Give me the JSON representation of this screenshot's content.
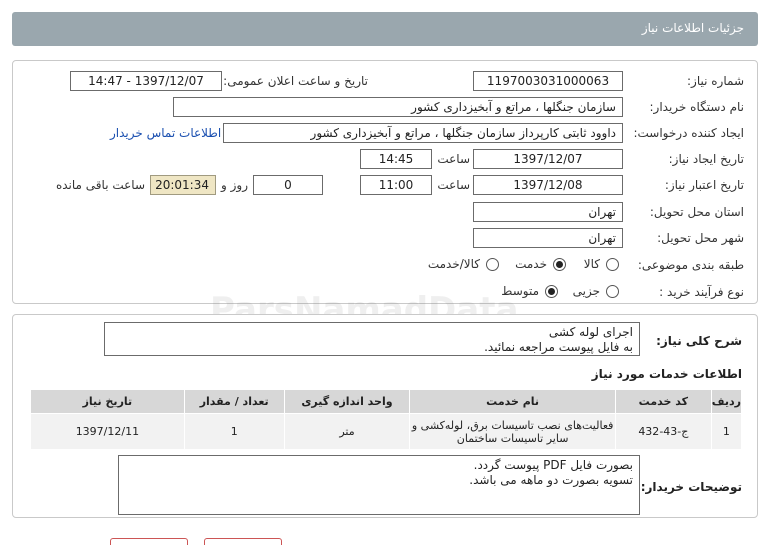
{
  "header": {
    "title": "جزئیات اطلاعات نیاز"
  },
  "form": {
    "need_number_label": "شماره نیاز:",
    "need_number": "1197003031000063",
    "announce_label": "تاریخ و ساعت اعلان عمومی:",
    "announce_value": "1397/12/07 - 14:47",
    "buyer_org_label": "نام دستگاه خریدار:",
    "buyer_org": "سازمان جنگلها ، مراتع و آبخیزداری کشور",
    "requester_label": "ایجاد کننده درخواست:",
    "requester": "داوود  ثابتی کارپرداز سازمان جنگلها ، مراتع و آبخیزداری کشور",
    "contact_link": "اطلاعات تماس خریدار",
    "created_label": "تاریخ ایجاد نیاز:",
    "created_date": "1397/12/07",
    "time_label": "ساعت",
    "created_time": "14:45",
    "validity_label": "تاریخ اعتبار نیاز:",
    "validity_date": "1397/12/08",
    "validity_time": "11:00",
    "days_label": "روز و",
    "days_value": "0",
    "remaining_time": "20:01:34",
    "remaining_label": "ساعت باقی مانده",
    "province_label": "استان محل تحویل:",
    "province": "تهران",
    "city_label": "شهر محل تحویل:",
    "city": "تهران",
    "category_label": "طبقه بندی موضوعی:",
    "category_options": {
      "goods": "کالا",
      "service": "خدمت",
      "goods_service": "کالا/خدمت"
    },
    "process_label": "نوع فرآیند خرید :",
    "process_options": {
      "partial": "جزیی",
      "medium": "متوسط"
    }
  },
  "summary": {
    "label": "شرح کلی نیاز:",
    "line1": "اجرای لوله کشی",
    "line2": "به فایل پیوست مراجعه نمائید."
  },
  "services": {
    "title": "اطلاعات خدمات مورد نیاز",
    "columns": [
      "ردیف",
      "کد خدمت",
      "نام خدمت",
      "واحد اندازه گیری",
      "تعداد / مقدار",
      "تاریخ نیاز"
    ],
    "rows": [
      {
        "row": "1",
        "code": "ج-43-432",
        "name": "فعالیت‌های نصب تاسیسات برق، لوله‌کشی و سایر تاسیسات ساختمان",
        "unit": "متر",
        "qty": "1",
        "date": "1397/12/11"
      }
    ]
  },
  "buyer_notes": {
    "label": "توضیحات خریدار:",
    "line1": "بصورت فایل PDF پیوست گردد.",
    "line2": "تسویه بصورت دو ماهه می باشد."
  },
  "watermark": "ParsNamadData"
}
